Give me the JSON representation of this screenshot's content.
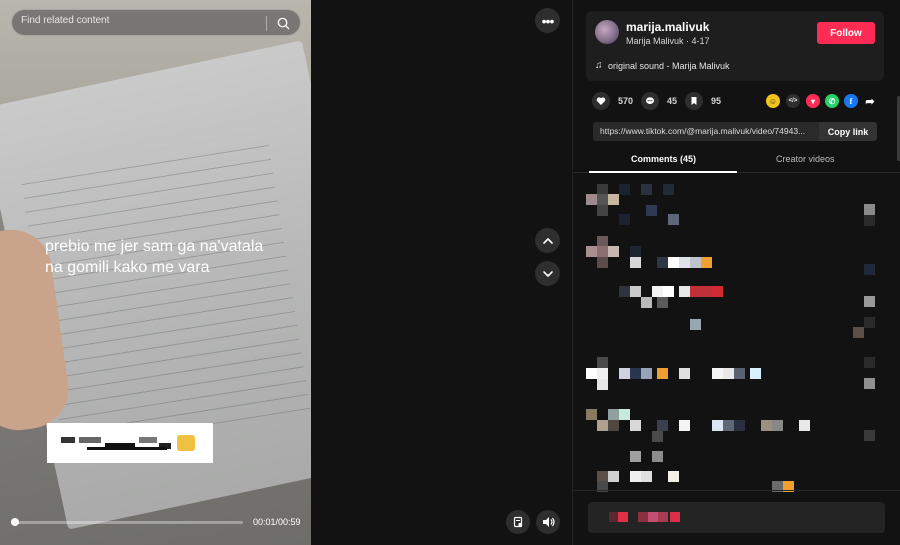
{
  "search": {
    "placeholder": "Find related content"
  },
  "video": {
    "caption": "prebio me jer sam ga na'vatala na gomili kako me vara",
    "time": "00:01/00:59",
    "progress": 0.015
  },
  "controls": {
    "more_label": "•••"
  },
  "author": {
    "username": "marija.malivuk",
    "subline": "Marija Malivuk · 4-17",
    "follow_label": "Follow",
    "sound": "original sound - Marija Malivuk"
  },
  "stats": {
    "likes": "570",
    "comments": "45",
    "saves": "95"
  },
  "share": {
    "link": "https://www.tiktok.com/@marija.malivuk/video/74943...",
    "copy_label": "Copy link"
  },
  "tabs": {
    "comments": "Comments (45)",
    "creator": "Creator videos"
  },
  "colors": {
    "accent": "#fe2c55",
    "background": "#121212",
    "card": "#1e1e1e"
  },
  "icons": [
    "search-icon",
    "more-icon",
    "chevron-up-icon",
    "chevron-down-icon",
    "report-icon",
    "volume-icon",
    "music-note-icon",
    "heart-icon",
    "comment-icon",
    "bookmark-icon",
    "embed-icon",
    "whatsapp-icon",
    "facebook-icon",
    "share-arrow-icon"
  ]
}
